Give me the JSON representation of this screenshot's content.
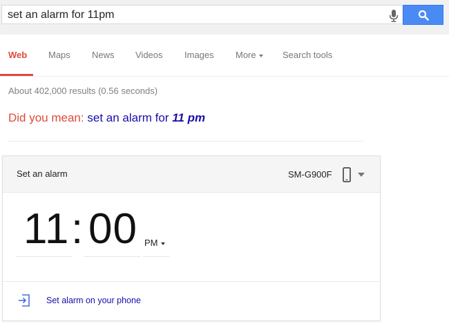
{
  "search": {
    "query": "set an alarm for 11pm",
    "mic_icon": "microphone-icon",
    "button_icon": "magnifier-icon",
    "button_color": "#4a8af4"
  },
  "tabs": [
    {
      "label": "Web",
      "active": true
    },
    {
      "label": "Maps"
    },
    {
      "label": "News"
    },
    {
      "label": "Videos"
    },
    {
      "label": "Images"
    },
    {
      "label": "More",
      "has_caret": true
    },
    {
      "label": "Search tools"
    }
  ],
  "results": {
    "stats": "About 402,000 results (0.56 seconds)",
    "did_you_mean_label": "Did you mean:",
    "suggestion_prefix": "set an alarm for",
    "suggestion_bold": "11 pm"
  },
  "alarm_card": {
    "title": "Set an alarm",
    "device": "SM-G900F",
    "device_icon": "phone-icon",
    "hour": "11",
    "separator": ":",
    "minute": "00",
    "meridiem": "PM",
    "action_label": "Set alarm on your phone",
    "action_icon": "send-to-phone-icon"
  },
  "colors": {
    "accent_red": "#dd4b39",
    "link_blue": "#1a0dab"
  }
}
